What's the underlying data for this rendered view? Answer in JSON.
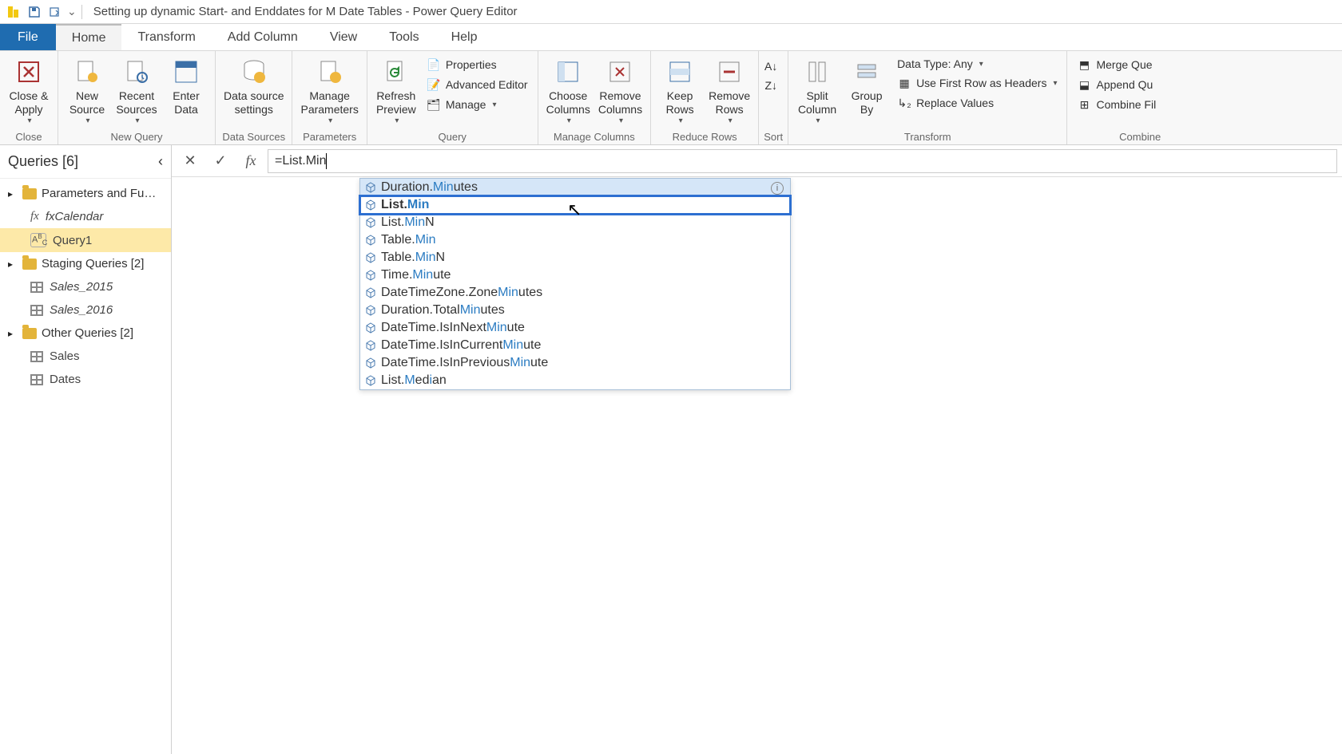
{
  "title": "Setting up dynamic Start- and Enddates for M Date Tables - Power Query Editor",
  "menu": {
    "file": "File",
    "home": "Home",
    "transform": "Transform",
    "add_column": "Add Column",
    "view": "View",
    "tools": "Tools",
    "help": "Help"
  },
  "ribbon": {
    "close_apply": "Close &\nApply",
    "close_group": "Close",
    "new_source": "New\nSource",
    "recent_sources": "Recent\nSources",
    "enter_data": "Enter\nData",
    "new_query_group": "New Query",
    "data_source_settings": "Data source\nsettings",
    "data_sources_group": "Data Sources",
    "manage_parameters": "Manage\nParameters",
    "parameters_group": "Parameters",
    "refresh_preview": "Refresh\nPreview",
    "properties": "Properties",
    "advanced_editor": "Advanced Editor",
    "manage": "Manage",
    "query_group": "Query",
    "choose_columns": "Choose\nColumns",
    "remove_columns": "Remove\nColumns",
    "manage_columns_group": "Manage Columns",
    "keep_rows": "Keep\nRows",
    "remove_rows": "Remove\nRows",
    "reduce_rows_group": "Reduce Rows",
    "sort_group": "Sort",
    "split_column": "Split\nColumn",
    "group_by": "Group\nBy",
    "data_type": "Data Type: Any",
    "first_row_headers": "Use First Row as Headers",
    "replace_values": "Replace Values",
    "transform_group": "Transform",
    "merge_queries": "Merge Que",
    "append_queries": "Append Qu",
    "combine_files": "Combine Fil",
    "combine_group": "Combine"
  },
  "sidebar": {
    "header": "Queries [6]",
    "groups": {
      "g0": {
        "label": "Parameters and Fu…"
      },
      "g1": {
        "label": "Staging Queries [2]"
      },
      "g2": {
        "label": "Other Queries [2]"
      }
    },
    "items": {
      "fxCalendar": "fxCalendar",
      "query1": "Query1",
      "sales2015": "Sales_2015",
      "sales2016": "Sales_2016",
      "sales": "Sales",
      "dates": "Dates"
    }
  },
  "formula": {
    "prefix": "= ",
    "text": "List.Min"
  },
  "autocomplete": {
    "items": [
      {
        "pre": "Duration.",
        "match": "Min",
        "post": "utes",
        "hover": true,
        "info": true
      },
      {
        "pre": "List.",
        "match": "Min",
        "post": "",
        "selected": true
      },
      {
        "pre": "List.",
        "match": "Min",
        "post": "N"
      },
      {
        "pre": "Table.",
        "match": "Min",
        "post": ""
      },
      {
        "pre": "Table.",
        "match": "Min",
        "post": "N"
      },
      {
        "pre": "Time.",
        "match": "Min",
        "post": "ute"
      },
      {
        "pre": "DateTimeZone.Zone",
        "match": "Min",
        "post": "utes"
      },
      {
        "pre": "Duration.Total",
        "match": "Min",
        "post": "utes"
      },
      {
        "pre": "DateTime.IsInNext",
        "match": "Min",
        "post": "ute"
      },
      {
        "pre": "DateTime.IsInCurrent",
        "match": "Min",
        "post": "ute"
      },
      {
        "pre": "DateTime.IsInPrevious",
        "match": "Min",
        "post": "ute"
      },
      {
        "pre": "List.",
        "match": "M",
        "post": "ed",
        "match2": "i",
        "post2": "an"
      }
    ]
  }
}
